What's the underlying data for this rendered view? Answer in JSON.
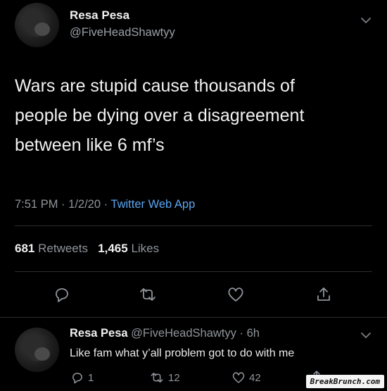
{
  "tweet": {
    "author_name": "Resa Pesa",
    "author_handle": "@FiveHeadShawtyy",
    "text_lines": [
      "Wars are stupid cause thousands of",
      "people be dying over a disagreement",
      "between like 6 mf’s"
    ],
    "time": "7:51 PM",
    "date": "1/2/20",
    "separator": "·",
    "source_app": "Twitter Web App",
    "retweets_count": "681",
    "retweets_label": "Retweets",
    "likes_count": "1,465",
    "likes_label": "Likes",
    "actions": [
      "reply-icon",
      "retweet-icon",
      "like-icon",
      "share-icon"
    ]
  },
  "reply": {
    "author_name": "Resa Pesa",
    "author_handle": "@FiveHeadShawtyy",
    "age": "· 6h",
    "text": "Like fam what y’all problem got to do with me",
    "reply_count": "1",
    "retweet_count": "12",
    "like_count": "42"
  },
  "watermark": "BreakBrunch.com",
  "colors": {
    "background": "#000000",
    "text": "#f2f2f2",
    "muted": "#8f949a",
    "link": "#5aa6f2",
    "divider": "#2a2d30"
  }
}
